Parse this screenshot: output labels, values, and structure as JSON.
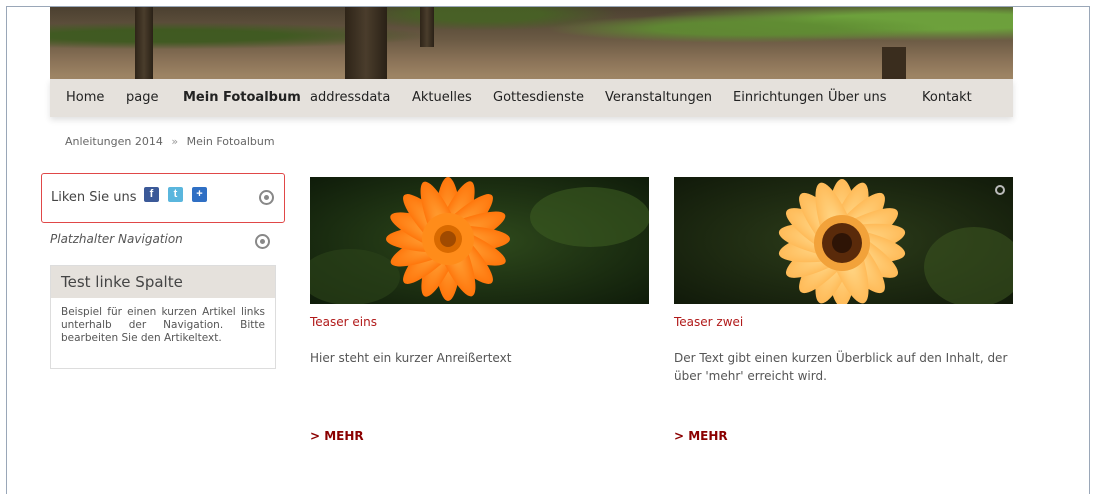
{
  "nav": {
    "items": [
      {
        "label": "Home",
        "active": false
      },
      {
        "label": "page",
        "active": false
      },
      {
        "label": "Mein Fotoalbum",
        "active": true
      },
      {
        "label": "addressdata",
        "active": false
      },
      {
        "label": "Aktuelles",
        "active": false
      },
      {
        "label": "Gottesdienste",
        "active": false
      },
      {
        "label": "Veranstaltungen",
        "active": false
      },
      {
        "label": "Einrichtungen",
        "active": false
      },
      {
        "label": "Über uns",
        "active": false
      },
      {
        "label": "Kontakt",
        "active": false
      }
    ]
  },
  "breadcrumb": {
    "items": [
      "Anleitungen 2014",
      "Mein Fotoalbum"
    ],
    "separator": "»"
  },
  "sidebar": {
    "like_label": "Liken Sie uns",
    "social_icons": [
      "facebook-icon",
      "twitter-icon",
      "plus-icon"
    ],
    "placeholder_nav": "Platzhalter Navigation",
    "box": {
      "title": "Test linke Spalte",
      "text": "Beispiel für einen kurzen Artikel links unterhalb der Navigation. Bitte bearbeiten Sie den Artikeltext."
    }
  },
  "teasers": [
    {
      "title": "Teaser eins",
      "text": "Hier steht ein kurzer Anreißertext",
      "more": "> MEHR",
      "image": "orange-flower"
    },
    {
      "title": "Teaser zwei",
      "text": "Der Text gibt einen kurzen Überblick auf den Inhalt, der über 'mehr' erreicht wird.",
      "more": "> MEHR",
      "image": "yellow-flower"
    }
  ],
  "colors": {
    "nav_bg": "#e5e1dc",
    "teaser_title": "#b11a1a",
    "more_link": "#8b0000",
    "highlight_border": "#e04848"
  }
}
